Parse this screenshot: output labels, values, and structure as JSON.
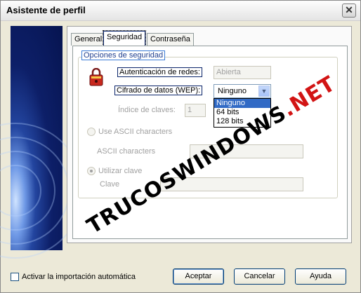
{
  "window": {
    "title": "Asistente de perfil"
  },
  "tabs": [
    "General",
    "Seguridad",
    "Contraseña"
  ],
  "security": {
    "group_title": "Opciones de seguridad",
    "network_auth_label": "Autenticación de redes:",
    "network_auth_value": "Abierta",
    "encryption_label": "Cifrado de datos (WEP):",
    "encryption_value": "Ninguno",
    "encryption_options": [
      "Ninguno",
      "64 bits",
      "128 bits"
    ],
    "key_index_label": "Índice de claves:",
    "key_index_value": "1",
    "ascii_radio_label": "Use ASCII characters",
    "ascii_field_label": "ASCII characters",
    "key_radio_label": "Utilizar clave",
    "key_field_label": "Clave"
  },
  "footer": {
    "auto_import_label": "Activar la importación automática",
    "accept_label": "Aceptar",
    "cancel_label": "Cancelar",
    "help_label": "Ayuda"
  },
  "watermark": {
    "main": "TRUCOSWINDOWS",
    "suffix": ".NET"
  },
  "colors": {
    "selection": "#316ac5",
    "watermark_suffix": "#d21414",
    "side_panel": "#0d1f68"
  },
  "icons": {
    "lock": "lock-icon",
    "close": "close-icon",
    "dropdown": "chevron-down-icon"
  }
}
